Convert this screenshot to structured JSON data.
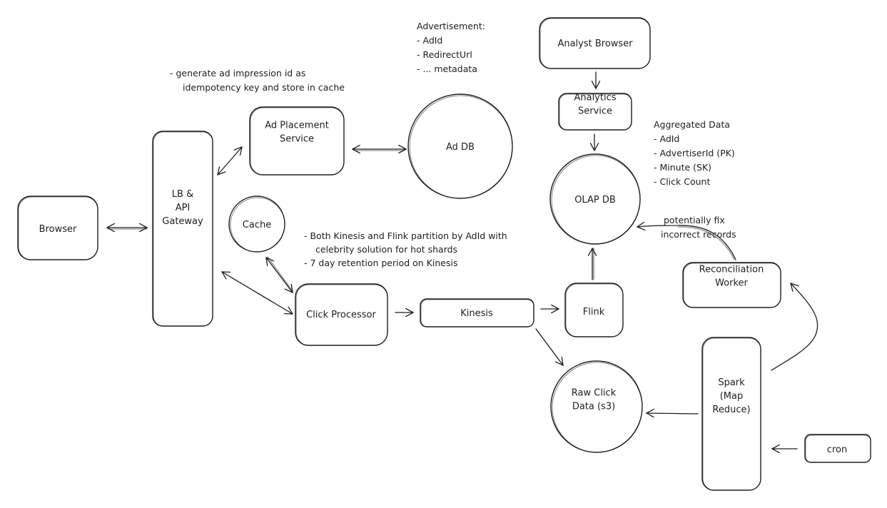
{
  "diagram": {
    "nodes": {
      "browser": {
        "label": [
          "Browser"
        ]
      },
      "gateway": {
        "label": [
          "LB &",
          "API",
          "Gateway"
        ]
      },
      "ad_placement": {
        "label": [
          "Ad Placement",
          "Service"
        ]
      },
      "ad_db": {
        "label": [
          "Ad DB"
        ]
      },
      "cache": {
        "label": [
          "Cache"
        ]
      },
      "click_processor": {
        "label": [
          "Click Processor"
        ]
      },
      "kinesis": {
        "label": [
          "Kinesis"
        ]
      },
      "flink": {
        "label": [
          "Flink"
        ]
      },
      "olap_db": {
        "label": [
          "OLAP DB"
        ]
      },
      "analyst_browser": {
        "label": [
          "Analyst Browser"
        ]
      },
      "analytics_service": {
        "label": [
          "Analytics",
          "Service"
        ]
      },
      "raw_click": {
        "label": [
          "Raw Click",
          "Data (s3)"
        ]
      },
      "spark": {
        "label": [
          "Spark",
          "(Map",
          "Reduce)"
        ]
      },
      "reconciliation": {
        "label": [
          "Reconciliation",
          "Worker"
        ]
      },
      "cron": {
        "label": [
          "cron"
        ]
      }
    },
    "notes": {
      "advertisement": [
        "Advertisement:",
        "- AdId",
        "- RedirectUrl",
        "- ... metadata"
      ],
      "impression": [
        "- generate ad impression id as",
        "idempotency key and store in cache"
      ],
      "aggregated": [
        "Aggregated Data",
        "- AdId",
        "- AdvertiserId (PK)",
        "- Minute (SK)",
        "- Click Count"
      ],
      "partition": [
        "- Both Kinesis and Flink partition by AdId with",
        "celebrity solution for hot shards",
        "- 7 day retention period on Kinesis"
      ],
      "fix": [
        "potentially fix",
        "incorrect records"
      ]
    },
    "edges": [
      {
        "from": "browser",
        "to": "gateway",
        "direction": "both"
      },
      {
        "from": "gateway",
        "to": "ad_placement",
        "direction": "both"
      },
      {
        "from": "ad_placement",
        "to": "ad_db",
        "direction": "both"
      },
      {
        "from": "gateway",
        "to": "click_processor",
        "direction": "both"
      },
      {
        "from": "cache",
        "to": "click_processor",
        "direction": "both"
      },
      {
        "from": "click_processor",
        "to": "kinesis",
        "direction": "forward"
      },
      {
        "from": "kinesis",
        "to": "flink",
        "direction": "forward"
      },
      {
        "from": "kinesis",
        "to": "raw_click",
        "direction": "forward"
      },
      {
        "from": "flink",
        "to": "olap_db",
        "direction": "forward"
      },
      {
        "from": "analyst_browser",
        "to": "analytics_service",
        "direction": "forward"
      },
      {
        "from": "analytics_service",
        "to": "olap_db",
        "direction": "forward"
      },
      {
        "from": "spark",
        "to": "raw_click",
        "direction": "forward"
      },
      {
        "from": "cron",
        "to": "spark",
        "direction": "forward"
      },
      {
        "from": "spark",
        "to": "reconciliation",
        "direction": "forward"
      },
      {
        "from": "reconciliation",
        "to": "olap_db",
        "direction": "forward"
      }
    ]
  }
}
